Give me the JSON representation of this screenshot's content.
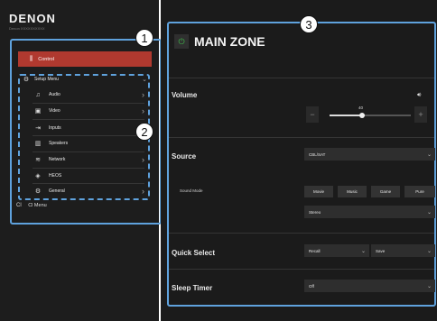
{
  "sidebar": {
    "brand": "DENON",
    "model": "Denon XXXXXXXXXX",
    "control_label": "Control",
    "setup_label": "Setup Menu",
    "items": [
      {
        "label": "Audio"
      },
      {
        "label": "Video"
      },
      {
        "label": "Inputs"
      },
      {
        "label": "Speakers"
      },
      {
        "label": "Network"
      },
      {
        "label": "HEOS"
      },
      {
        "label": "General"
      }
    ],
    "cl_menu_label": "Cl Menu",
    "cl_menu_icon": "Cl"
  },
  "callouts": [
    "1",
    "2",
    "3"
  ],
  "zone": {
    "title": "MAIN ZONE"
  },
  "volume": {
    "label": "Volume",
    "value": "40",
    "level": 0.4,
    "minus": "−",
    "plus": "+"
  },
  "source": {
    "label": "Source",
    "value": "CBL/SAT",
    "sound_mode_label": "Sound Mode",
    "modes": [
      "Movie",
      "Music",
      "Game",
      "Pure"
    ],
    "mode_value": "Stereo"
  },
  "quick_select": {
    "label": "Quick Select",
    "recall": "Recall",
    "save": "Save"
  },
  "sleep_timer": {
    "label": "Sleep Timer",
    "value": "Off"
  },
  "colors": {
    "accent": "#5fa2dd",
    "control_active": "#b0392f",
    "power": "#3fb84a"
  },
  "icons": {
    "control": "sliders-icon",
    "setup": "wrench-gear-icon",
    "audio": "music-note-icon",
    "video": "video-icon",
    "inputs": "input-icon",
    "speakers": "speakers-icon",
    "network": "wifi-icon",
    "heos": "heos-icon",
    "general": "gear-icon",
    "power": "power-icon",
    "volume": "speaker-icon"
  }
}
